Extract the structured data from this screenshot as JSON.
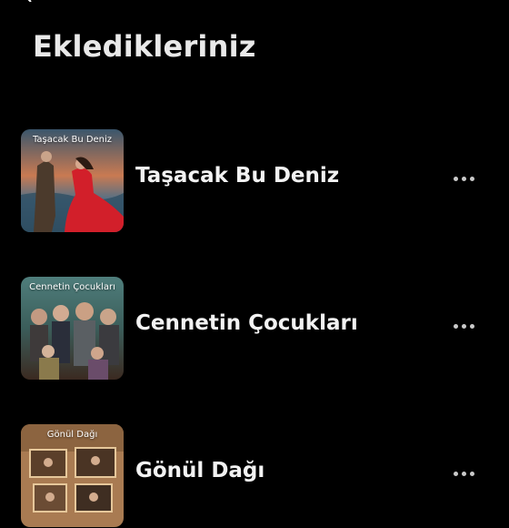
{
  "page": {
    "title": "Ekledikleriniz"
  },
  "items": [
    {
      "title": "Taşacak Bu Deniz",
      "poster_caption": "Taşacak Bu Deniz",
      "more_icon": "more-horizontal-icon"
    },
    {
      "title": "Cennetin Çocukları",
      "poster_caption": "Cennetin Çocukları",
      "more_icon": "more-horizontal-icon"
    },
    {
      "title": "Gönül Dağı",
      "poster_caption": "Gönül Dağı",
      "more_icon": "more-horizontal-icon"
    }
  ],
  "colors": {
    "background": "#000000",
    "text": "#f2f2f2",
    "dots": "#c9c9c9"
  }
}
